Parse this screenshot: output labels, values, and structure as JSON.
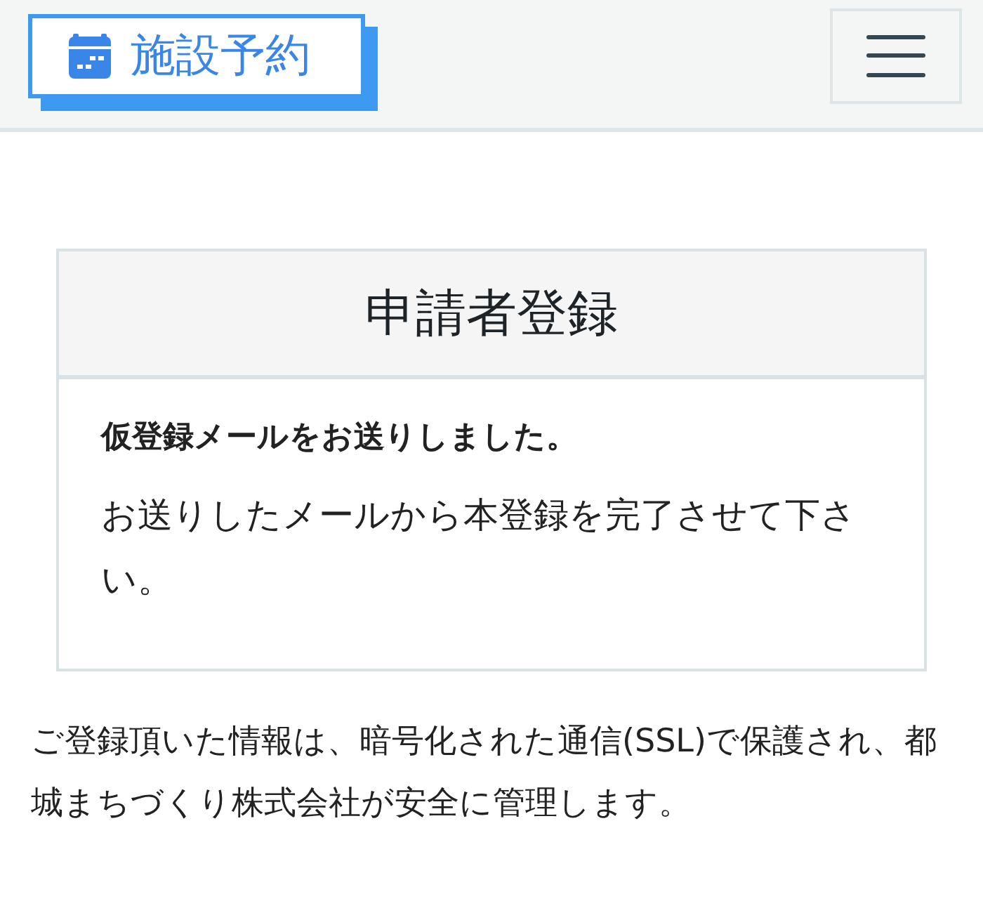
{
  "header": {
    "logo": "施設予約"
  },
  "card": {
    "title": "申請者登録",
    "message": "仮登録メールをお送りしました。",
    "instruction": "お送りしたメールから本登録を完了させて下さい。"
  },
  "footer_note": "ご登録頂いた情報は、暗号化された通信(SSL)で保護され、都城まちづくり株式会社が安全に管理します。"
}
